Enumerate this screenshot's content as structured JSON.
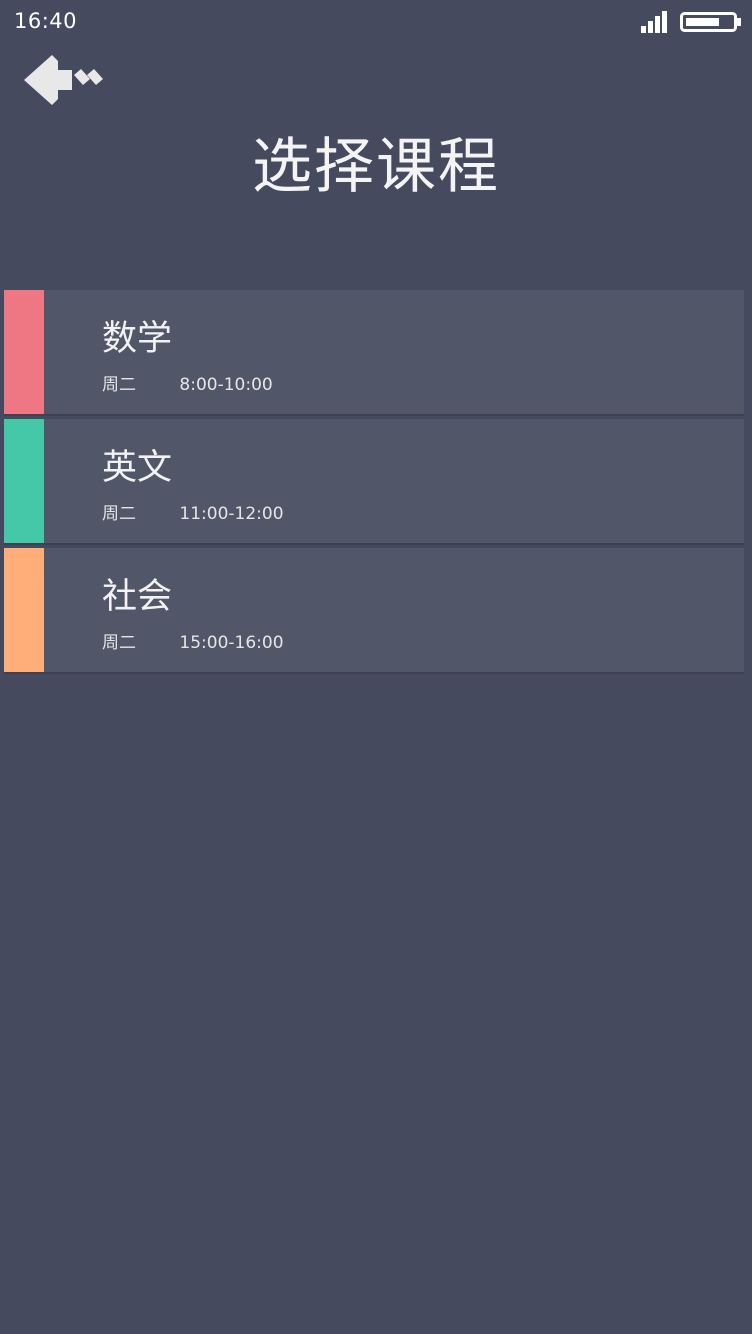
{
  "status_bar": {
    "time": "16:40",
    "signal_icon": "signal-bars-icon",
    "battery_icon": "battery-icon"
  },
  "header": {
    "back_icon": "back-arrow-icon",
    "title": "选择课程"
  },
  "courses": [
    {
      "name": "数学",
      "day": "周二",
      "time": "8:00-10:00",
      "color": "#ef7683"
    },
    {
      "name": "英文",
      "day": "周二",
      "time": "11:00-12:00",
      "color": "#45c8a8"
    },
    {
      "name": "社会",
      "day": "周二",
      "time": "15:00-16:00",
      "color": "#ffae7a"
    }
  ],
  "colors": {
    "background": "#464a5e",
    "card": "#525669"
  }
}
